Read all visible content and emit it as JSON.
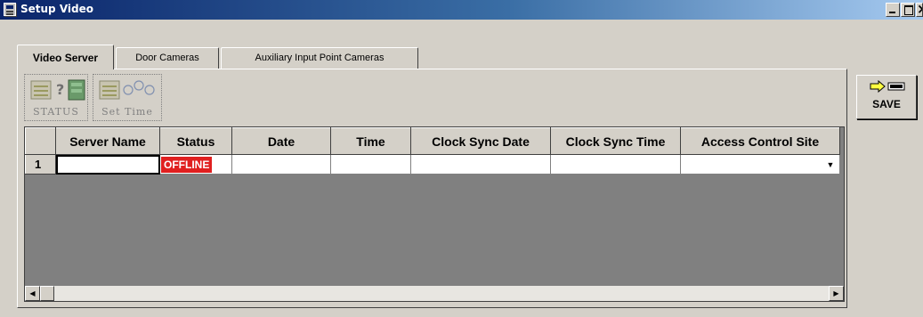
{
  "window": {
    "title": "Setup Video"
  },
  "tabs": [
    {
      "label": "Video Server",
      "active": true
    },
    {
      "label": "Door Cameras",
      "active": false
    },
    {
      "label": "Auxiliary Input Point Cameras",
      "active": false
    }
  ],
  "toolbar": {
    "status_label": "STATUS",
    "status_icon": "server-status-icon",
    "settime_label": "Set Time",
    "settime_icon": "clock-sync-icon"
  },
  "grid": {
    "columns": [
      "",
      "Server Name",
      "Status",
      "Date",
      "Time",
      "Clock Sync Date",
      "Clock Sync Time",
      "Access Control Site"
    ],
    "rows": [
      {
        "row_number": "1",
        "server_name": "",
        "status": "OFFLINE",
        "date": "",
        "time": "",
        "clock_sync_date": "",
        "clock_sync_time": "",
        "access_control_site": ""
      }
    ]
  },
  "save_button": {
    "label": "SAVE",
    "icon": "save-arrow-icon"
  },
  "colors": {
    "offline_badge": "#e02020",
    "titlebar_start": "#0a246a",
    "titlebar_end": "#a6caf0"
  }
}
